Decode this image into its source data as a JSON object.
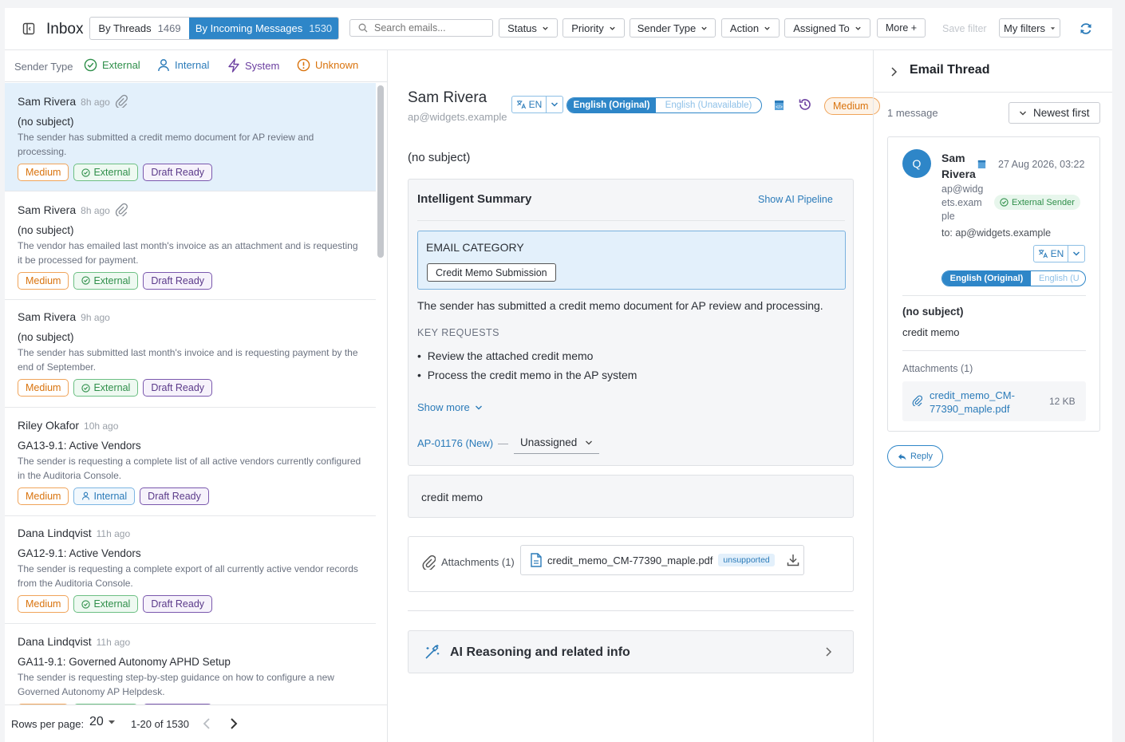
{
  "topbar": {
    "title": "Inbox",
    "view_threads_label": "By Threads",
    "view_threads_count": "1469",
    "view_incoming_label": "By Incoming Messages",
    "view_incoming_count": "1530",
    "search_placeholder": "Search emails...",
    "filters": [
      "Status",
      "Priority",
      "Sender Type",
      "Action",
      "Assigned To"
    ],
    "more_label": "More +",
    "save_filter_label": "Save filter",
    "my_filters_label": "My filters"
  },
  "sender_type_bar": {
    "label": "Sender Type",
    "types": [
      {
        "label": "External",
        "icon": "check-circle-icon",
        "color": "#2f8f4a"
      },
      {
        "label": "Internal",
        "icon": "person-icon",
        "color": "#2b7bb9"
      },
      {
        "label": "System",
        "icon": "bolt-icon",
        "color": "#6b3fa0"
      },
      {
        "label": "Unknown",
        "icon": "alert-circle-icon",
        "color": "#d9730d"
      }
    ]
  },
  "messages": [
    {
      "sender": "Sam Rivera",
      "ago": "8h ago",
      "attachment": true,
      "subject": "(no subject)",
      "preview": "The sender has submitted a credit memo document for AP review and processing.",
      "priority": "Medium",
      "sender_type": "External",
      "status": "Draft Ready",
      "selected": true
    },
    {
      "sender": "Sam Rivera",
      "ago": "8h ago",
      "attachment": true,
      "subject": "(no subject)",
      "preview": "The vendor has emailed last month's invoice as an attachment and is requesting it be processed for payment.",
      "priority": "Medium",
      "sender_type": "External",
      "status": "Draft Ready",
      "selected": false
    },
    {
      "sender": "Sam Rivera",
      "ago": "9h ago",
      "attachment": false,
      "subject": "(no subject)",
      "preview": "The sender has submitted last month's invoice and is requesting payment by the end of September.",
      "priority": "Medium",
      "sender_type": "External",
      "status": "Draft Ready",
      "selected": false
    },
    {
      "sender": "Riley Okafor",
      "ago": "10h ago",
      "attachment": false,
      "subject": "GA13-9.1: Active Vendors",
      "preview": "The sender is requesting a complete list of all active vendors currently configured in the Auditoria Console.",
      "priority": "Medium",
      "sender_type": "Internal",
      "status": "Draft Ready",
      "selected": false
    },
    {
      "sender": "Dana Lindqvist",
      "ago": "11h ago",
      "attachment": false,
      "subject": "GA12-9.1: Active Vendors",
      "preview": "The sender is requesting a complete export of all currently active vendor records from the Auditoria Console.",
      "priority": "Medium",
      "sender_type": "External",
      "status": "Draft Ready",
      "selected": false
    },
    {
      "sender": "Dana Lindqvist",
      "ago": "11h ago",
      "attachment": false,
      "subject": "GA11-9.1: Governed Autonomy APHD Setup",
      "preview": "The sender is requesting step-by-step guidance on how to configure a new Governed Autonomy AP Helpdesk.",
      "priority": "Medium",
      "sender_type": "External",
      "status": "Draft Ready",
      "selected": false
    }
  ],
  "pager": {
    "rows_label": "Rows per page:",
    "rows_value": "20",
    "range": "1-20 of 1530"
  },
  "detail": {
    "sender": "Sam Rivera",
    "email": "ap@widgets.example",
    "lang_code": "EN",
    "lang_original": "English (Original)",
    "lang_unavailable": "English (Unavailable)",
    "priority": "Medium",
    "subject": "(no subject)",
    "summary_title": "Intelligent Summary",
    "show_pipeline": "Show AI Pipeline",
    "category_heading": "EMAIL CATEGORY",
    "category_value": "Credit Memo Submission",
    "summary_text": "The sender has submitted a credit memo document for AP review and processing.",
    "key_requests_heading": "KEY REQUESTS",
    "key_requests": [
      "Review the attached credit memo",
      "Process the credit memo in the AP system"
    ],
    "show_more": "Show more",
    "ticket": "AP-01176 (New)",
    "dash": "—",
    "assignee": "Unassigned",
    "body": "credit memo",
    "attachments_label": "Attachments (1)",
    "attachment_name": "credit_memo_CM-77390_maple.pdf",
    "attachment_badge": "unsupported",
    "ai_reasoning": "AI Reasoning and related info"
  },
  "thread": {
    "title": "Email Thread",
    "count": "1 message",
    "sort": "Newest first",
    "avatar_letter": "Q",
    "sender_line1": "Sam",
    "sender_line2": "Rivera",
    "date": "27 Aug 2026, 03:22",
    "email_lines": [
      "ap@widg",
      "ets.exam",
      "ple"
    ],
    "sender_badge": "External Sender",
    "to": "to: ap@widgets.example",
    "lang_code": "EN",
    "lang_original": "English (Original)",
    "lang_other": "English (U",
    "subject": "(no subject)",
    "body": "credit memo",
    "attachments_label": "Attachments (1)",
    "attachment_line1": "credit_memo_CM-",
    "attachment_line2": "77390_maple.pdf",
    "attachment_size": "12 KB",
    "reply_label": "Reply"
  },
  "colors": {
    "accent": "#2b7bb9",
    "selected_bg": "#e3f0fb",
    "medium": "#d9730d",
    "external": "#2f8f4a",
    "draft": "#5b3a8a"
  }
}
